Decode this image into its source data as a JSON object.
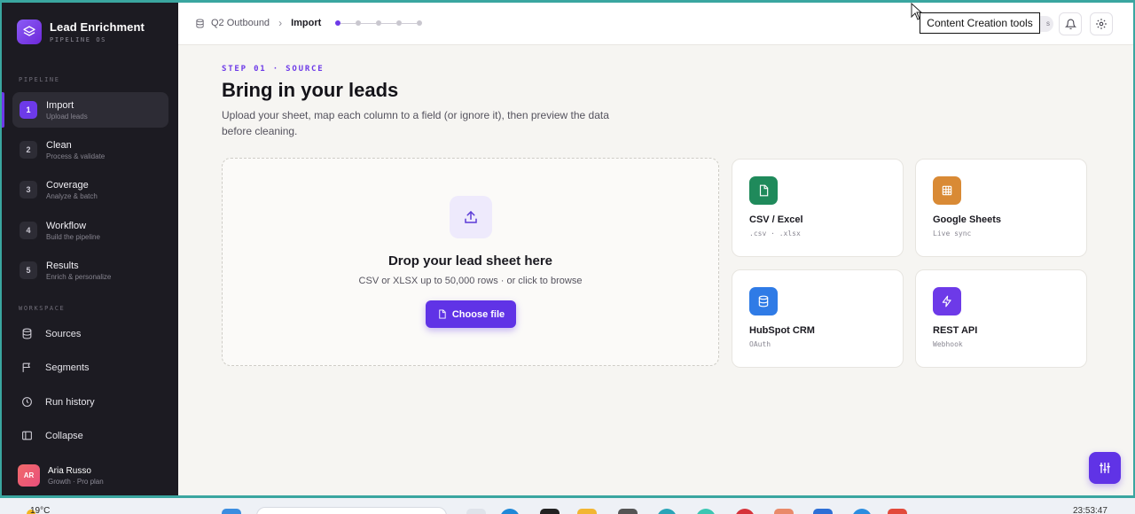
{
  "app": {
    "title": "Lead Enrichment",
    "subtitle": "PIPELINE OS"
  },
  "sidebar": {
    "pipeline_label": "PIPELINE",
    "steps": [
      {
        "num": "1",
        "title": "Import",
        "sub": "Upload leads"
      },
      {
        "num": "2",
        "title": "Clean",
        "sub": "Process & validate"
      },
      {
        "num": "3",
        "title": "Coverage",
        "sub": "Analyze & batch"
      },
      {
        "num": "4",
        "title": "Workflow",
        "sub": "Build the pipeline"
      },
      {
        "num": "5",
        "title": "Results",
        "sub": "Enrich & personalize"
      }
    ],
    "workspace_label": "WORKSPACE",
    "workspace": [
      {
        "label": "Sources",
        "icon": "database-icon"
      },
      {
        "label": "Segments",
        "icon": "flag-icon"
      },
      {
        "label": "Run history",
        "icon": "clock-icon"
      },
      {
        "label": "Collapse",
        "icon": "sidebar-panel-icon"
      }
    ],
    "user": {
      "initials": "AR",
      "name": "Aria Russo",
      "plan": "Growth · Pro plan"
    }
  },
  "topbar": {
    "breadcrumb_root": "Q2 Outbound",
    "breadcrumb_current": "Import",
    "tooltip": "Content Creation tools",
    "chip_fragment": "s"
  },
  "main": {
    "eyebrow": "STEP 01 · SOURCE",
    "title": "Bring in your leads",
    "description": "Upload your sheet, map each column to a field (or ignore it), then preview the data before cleaning.",
    "dropzone": {
      "title": "Drop your lead sheet here",
      "subtitle": "CSV or XLSX up to 50,000 rows · or click to browse",
      "button": "Choose file"
    },
    "sources": [
      {
        "title": "CSV / Excel",
        "sub": ".csv · .xlsx",
        "color": "#1f8a5b",
        "icon": "file-icon"
      },
      {
        "title": "Google Sheets",
        "sub": "Live sync",
        "color": "#d98a35",
        "icon": "grid-icon"
      },
      {
        "title": "HubSpot CRM",
        "sub": "OAuth",
        "color": "#2f7be6",
        "icon": "database-icon"
      },
      {
        "title": "REST API",
        "sub": "Webhook",
        "color": "#6d3ae8",
        "icon": "bolt-icon"
      }
    ]
  },
  "taskbar": {
    "temperature": "19°C",
    "clock": "23:53:47"
  },
  "colors": {
    "accent": "#6033e6",
    "sidebar_bg": "#1c1b22",
    "page_bg": "#f6f5f2"
  }
}
